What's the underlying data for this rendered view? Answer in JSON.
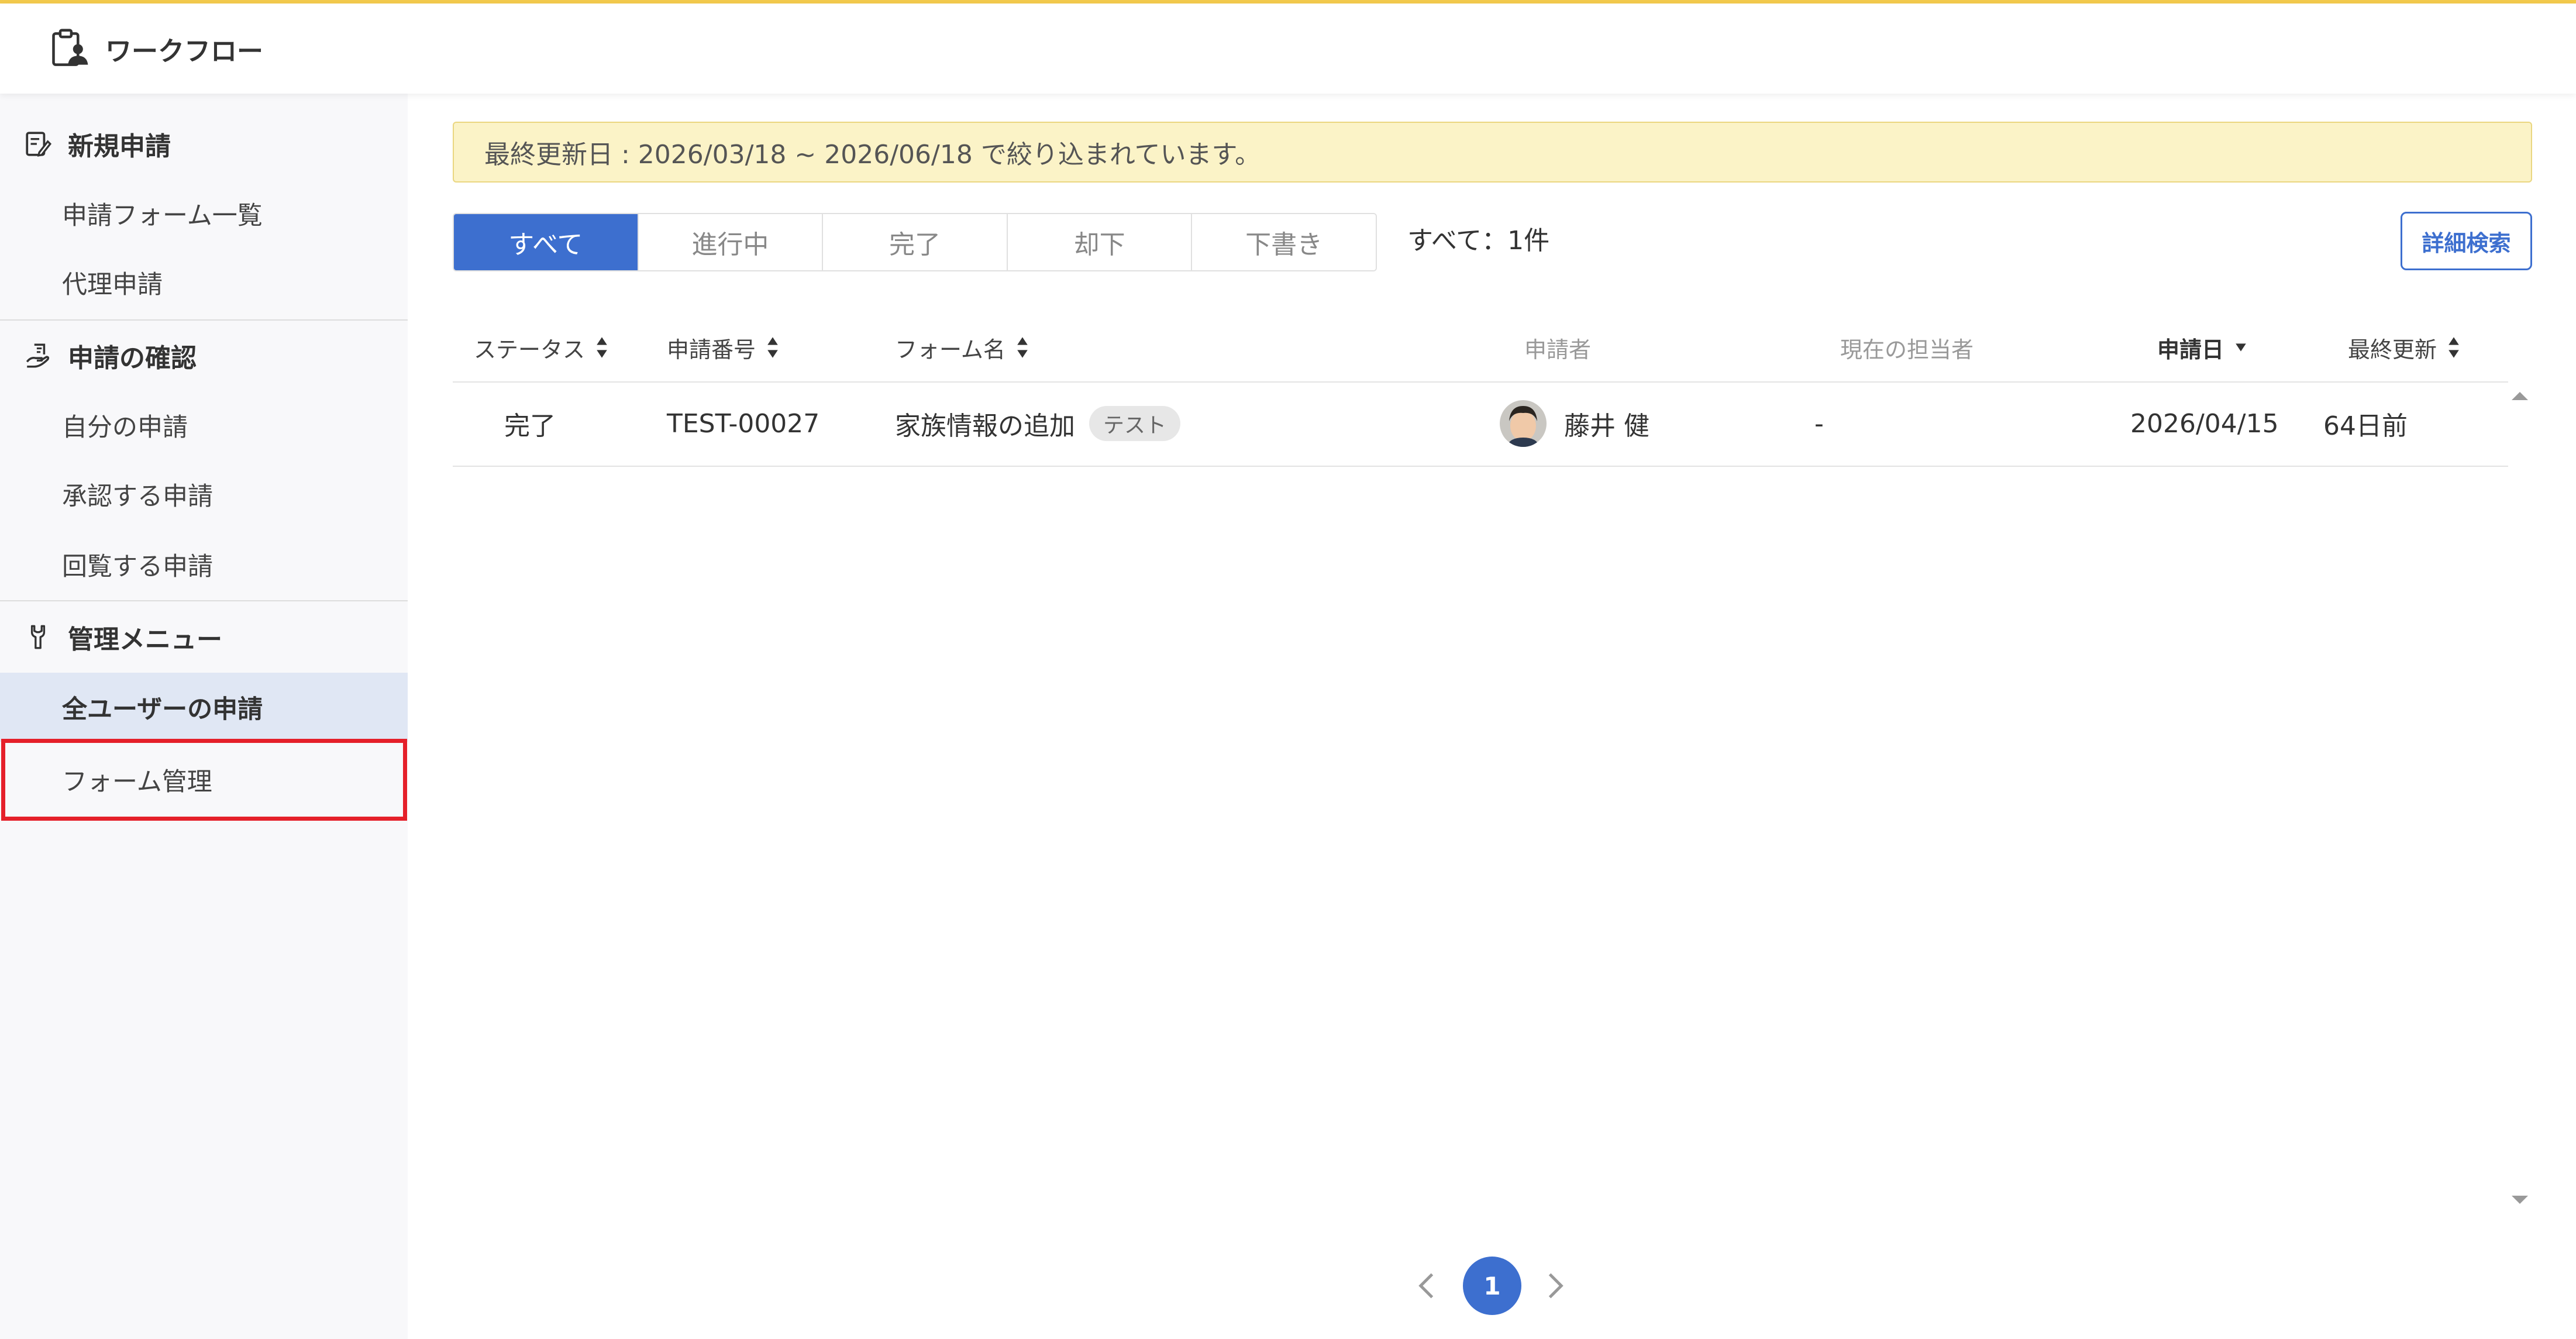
{
  "app": {
    "title": "ワークフロー"
  },
  "sidebar": {
    "sections": [
      {
        "title": "新規申請",
        "items": [
          {
            "label": "申請フォーム一覧"
          },
          {
            "label": "代理申請"
          }
        ]
      },
      {
        "title": "申請の確認",
        "items": [
          {
            "label": "自分の申請"
          },
          {
            "label": "承認する申請"
          },
          {
            "label": "回覧する申請"
          }
        ]
      },
      {
        "title": "管理メニュー",
        "items": [
          {
            "label": "全ユーザーの申請",
            "active": true
          },
          {
            "label": "フォーム管理",
            "highlighted": true
          }
        ]
      }
    ]
  },
  "filter_banner": {
    "text": "最終更新日 : 2026/03/18 ~ 2026/06/18 で絞り込まれています。"
  },
  "tabs": [
    {
      "label": "すべて",
      "active": true
    },
    {
      "label": "進行中"
    },
    {
      "label": "完了"
    },
    {
      "label": "却下"
    },
    {
      "label": "下書き"
    }
  ],
  "count_label": "すべて：1件",
  "detail_search_label": "詳細検索",
  "table": {
    "columns": [
      {
        "label": "ステータス",
        "sortable": true
      },
      {
        "label": "申請番号",
        "sortable": true
      },
      {
        "label": "フォーム名",
        "sortable": true
      },
      {
        "label": "申請者"
      },
      {
        "label": "現在の担当者"
      },
      {
        "label": "申請日",
        "sort": "desc"
      },
      {
        "label": "最終更新",
        "sortable": true
      }
    ],
    "rows": [
      {
        "status": "完了",
        "number": "TEST-00027",
        "form_name": "家族情報の追加",
        "tag": "テスト",
        "applicant": "藤井 健",
        "assignee": "-",
        "applied_date": "2026/04/15",
        "updated": "64日前"
      }
    ]
  },
  "pagination": {
    "current": "1"
  },
  "colors": {
    "accent": "#3d6fcf",
    "header_line": "#f2c94c",
    "banner_bg": "#fbf3c7",
    "highlight": "#e5202a"
  }
}
